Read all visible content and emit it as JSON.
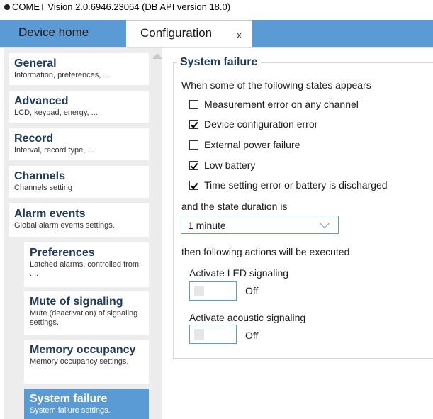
{
  "window": {
    "title": "COMET Vision 2.0.6946.23064 (DB API version 18.0)"
  },
  "tabs": [
    {
      "label": "Device home"
    },
    {
      "label": "Configuration",
      "close": "x"
    }
  ],
  "colors": {
    "accent": "#5b9bd5",
    "heading": "#1e3a5a",
    "sidebar_bg": "#ededed"
  },
  "sidebar": {
    "items": [
      {
        "title": "General",
        "subtitle": "Information, preferences, ..."
      },
      {
        "title": "Advanced",
        "subtitle": "LCD, keypad, energy, ..."
      },
      {
        "title": "Record",
        "subtitle": "Interval, record type, ..."
      },
      {
        "title": "Channels",
        "subtitle": "Channels setting"
      },
      {
        "title": "Alarm events",
        "subtitle": "Global alarm events settings."
      }
    ],
    "subitems": [
      {
        "title": "Preferences",
        "subtitle": "Latched alarms, controlled from ...."
      },
      {
        "title": "Mute of signaling",
        "subtitle": "Mute (deactivation) of signaling settings."
      },
      {
        "title": "Memory occupancy",
        "subtitle": "Memory occupancy settings."
      },
      {
        "title": "System failure",
        "subtitle": "System failure settings.",
        "selected": true
      }
    ]
  },
  "panel": {
    "title": "System failure",
    "intro": "When some of the following states appears",
    "checkboxes": [
      {
        "label": "Measurement error on any channel",
        "checked": false
      },
      {
        "label": "Device configuration error",
        "checked": true
      },
      {
        "label": "External power failure",
        "checked": false
      },
      {
        "label": "Low battery",
        "checked": true
      },
      {
        "label": "Time setting error or battery is discharged",
        "checked": true
      }
    ],
    "duration_label": "and the state duration is",
    "duration_value": "1 minute",
    "actions_label": "then following actions will be executed",
    "led": {
      "label": "Activate LED signaling",
      "state": "Off"
    },
    "acoustic": {
      "label": "Activate acoustic signaling",
      "state": "Off"
    }
  }
}
